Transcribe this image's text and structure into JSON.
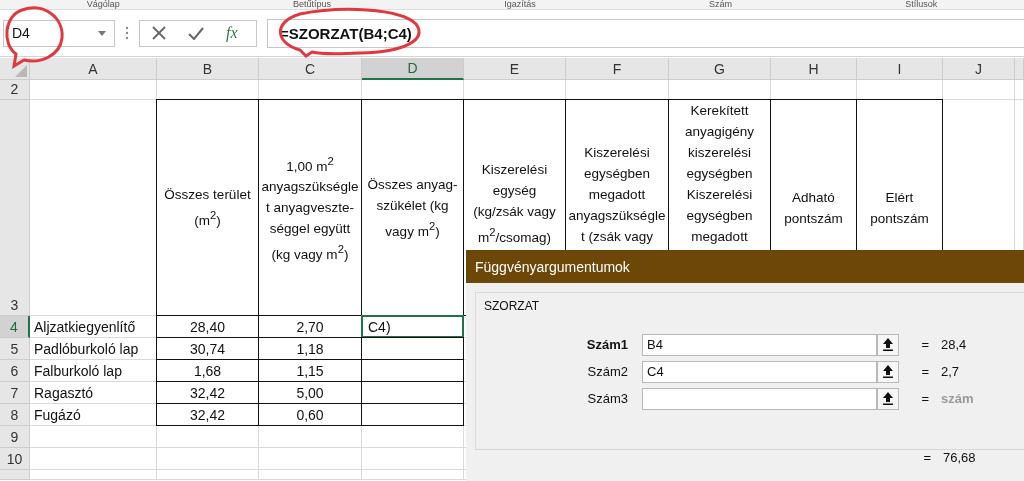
{
  "ribbon_groups": [
    "Vágólap",
    "Betűtípus",
    "Igazítás",
    "Szám",
    "Stílusok"
  ],
  "name_box": {
    "value": "D4"
  },
  "formula_bar": {
    "function_button": "fx",
    "formula": "=SZORZAT(B4;C4)"
  },
  "columns": [
    {
      "label": "A",
      "selected": false
    },
    {
      "label": "B",
      "selected": false
    },
    {
      "label": "C",
      "selected": false
    },
    {
      "label": "D",
      "selected": true
    },
    {
      "label": "E",
      "selected": false
    },
    {
      "label": "F",
      "selected": false
    },
    {
      "label": "G",
      "selected": false
    },
    {
      "label": "H",
      "selected": false
    },
    {
      "label": "I",
      "selected": false
    },
    {
      "label": "J",
      "selected": false
    }
  ],
  "rows": [
    {
      "number": "2",
      "selected": false,
      "cells": []
    },
    {
      "number": "3",
      "selected": false,
      "cells": [
        "",
        "Összes terület (m$^{2}$)",
        "1,00 m$^{2}$ anyagszükséglet anyagveszte-séggel együtt (kg vagy m$^{2}$)",
        "Összes anyag-szükélet (kg vagy m$^{2}$)",
        "Kiszerelési egység (kg/zsák vagy m$^{2}$/csomag)",
        "Kiszerelési egységben megadott anyagszükséglet (zsák vagy",
        "Kerekített anyagigény kiszerelési egységben Kiszerelési egységben megadott",
        "Adható pontszám",
        "Elért pontszám"
      ]
    },
    {
      "number": "4",
      "selected": true,
      "cells": [
        "Aljzatkiegyenlítő",
        "28,40",
        "2,70",
        "C4)"
      ]
    },
    {
      "number": "5",
      "selected": false,
      "cells": [
        "Padlóburkoló lap",
        "30,74",
        "1,18",
        ""
      ]
    },
    {
      "number": "6",
      "selected": false,
      "cells": [
        "Falburkoló lap",
        "1,68",
        "1,15",
        ""
      ]
    },
    {
      "number": "7",
      "selected": false,
      "cells": [
        "Ragasztó",
        "32,42",
        "5,00",
        ""
      ]
    },
    {
      "number": "8",
      "selected": false,
      "cells": [
        "Fugázó",
        "32,42",
        "0,60",
        ""
      ]
    },
    {
      "number": "9",
      "selected": false,
      "cells": []
    },
    {
      "number": "10",
      "selected": false,
      "cells": []
    }
  ],
  "dialog": {
    "title": "Függvényargumentumok",
    "function_name": "SZORZAT",
    "arguments": [
      {
        "label": "Szám1",
        "value": "B4",
        "equals": "=",
        "result": "28,4",
        "greyed": false,
        "active": true
      },
      {
        "label": "Szám2",
        "value": "C4",
        "equals": "=",
        "result": "2,7",
        "greyed": false,
        "active": false
      },
      {
        "label": "Szám3",
        "equals": "=",
        "result": "szám",
        "greyed": true,
        "active": false
      }
    ],
    "result_equals": "=",
    "result": "76,68"
  }
}
